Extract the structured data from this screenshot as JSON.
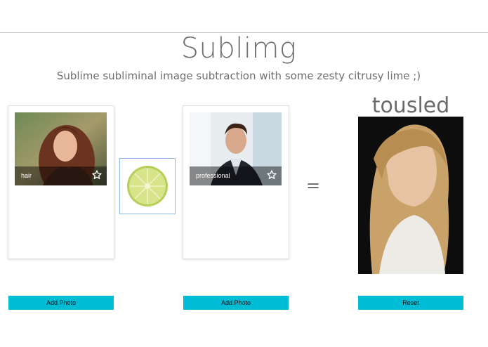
{
  "header": {
    "title": "Sublimg",
    "subtitle": "Sublime subliminal image subtraction with some zesty citrusy lime ;)"
  },
  "cards": [
    {
      "caption": "hair",
      "star_icon": "star-outline-icon"
    },
    {
      "caption": "professional",
      "star_icon": "star-outline-icon"
    }
  ],
  "operator": {
    "lime_icon": "lime-slice-icon",
    "equals": "="
  },
  "result": {
    "label": "tousled"
  },
  "buttons": {
    "add_photo_1": "Add Photo",
    "add_photo_2": "Add Photo",
    "reset": "Reset"
  },
  "colors": {
    "accent": "#00bcd4",
    "title_text": "#6f6f6f",
    "lime_box_border": "#8fb8ea"
  }
}
